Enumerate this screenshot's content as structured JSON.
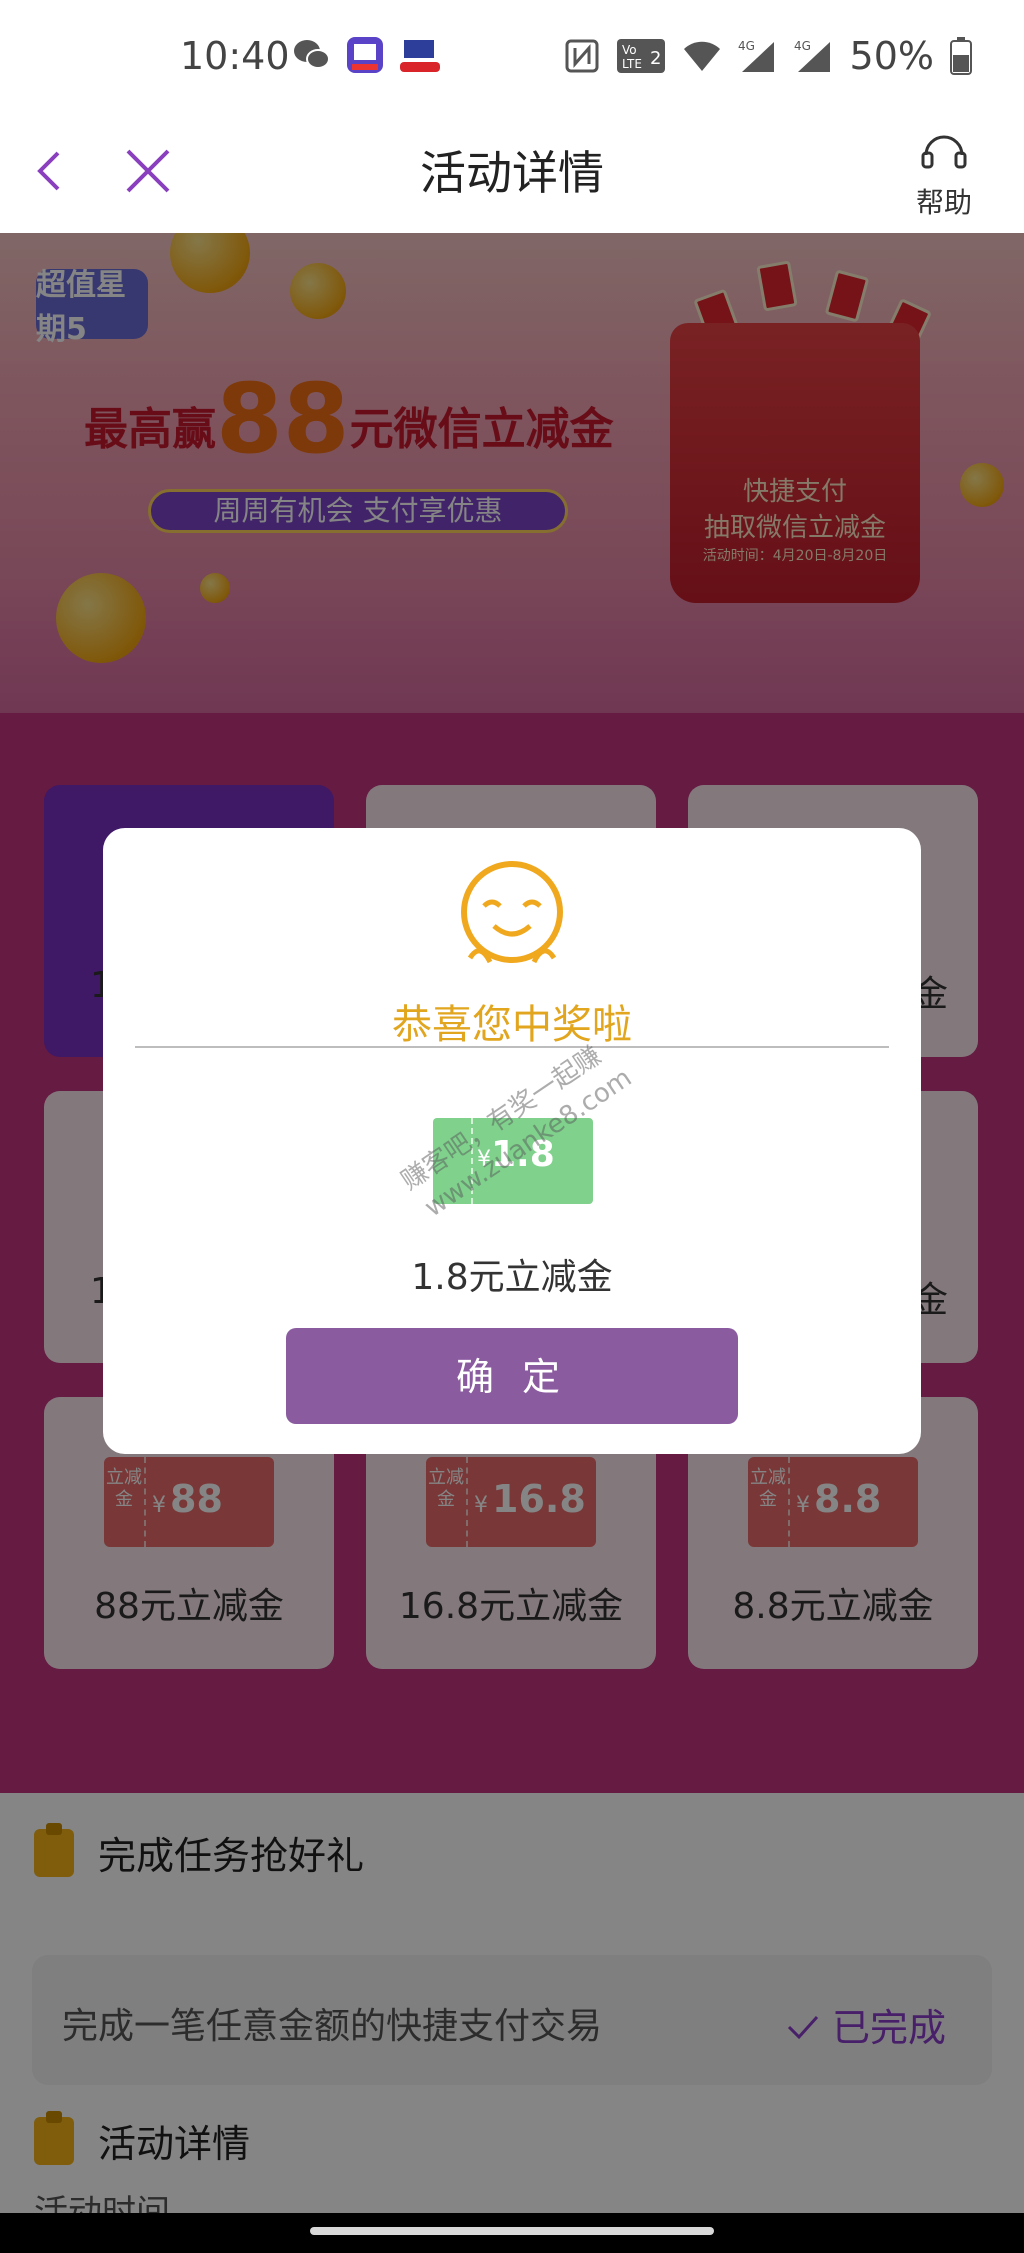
{
  "status_bar": {
    "time": "10:40",
    "left_icons": [
      "wechat-icon",
      "tie-app-icon",
      "bank-app-icon"
    ],
    "right_icons": [
      "nfc-icon",
      "volte-icon",
      "wifi-icon",
      "signal-4g-icon",
      "signal-4g-icon"
    ],
    "battery_percent": "50%"
  },
  "nav": {
    "title": "活动详情",
    "help_label": "帮助"
  },
  "banner": {
    "logo_text": "超值星期5",
    "headline_prefix": "最高赢",
    "headline_number": "88",
    "headline_suffix": "元微信立减金",
    "pill_text": "周周有机会 支付享优惠",
    "bag_line1": "快捷支付",
    "bag_line2": "抽取微信立减金",
    "bag_line3": "活动时间：4月20日-8月20日"
  },
  "prizes": [
    {
      "label": "1",
      "value": "",
      "active": true
    },
    {
      "label": "",
      "value": ""
    },
    {
      "label": "金",
      "value": ""
    },
    {
      "label": "1",
      "value": ""
    },
    {
      "label": "",
      "value": ""
    },
    {
      "label": "金",
      "value": ""
    },
    {
      "label": "88元立减金",
      "value": "88"
    },
    {
      "label": "16.8元立减金",
      "value": "16.8"
    },
    {
      "label": "8.8元立减金",
      "value": "8.8"
    }
  ],
  "voucher_side_text": "立减金",
  "currency": "¥",
  "info": {
    "task_title": "完成任务抢好礼",
    "task_desc": "完成一笔任意金额的快捷支付交易",
    "task_status": "已完成",
    "detail_title": "活动详情",
    "detail_sub": "活动时间"
  },
  "modal": {
    "title": "恭喜您中奖啦",
    "coupon_value": "1.8",
    "coupon_side": "立减金",
    "prize_text": "1.8元立减金",
    "confirm_label": "确 定",
    "watermark_1": "赚客吧，有奖一起赚",
    "watermark_2": "www.zuanke8.com"
  },
  "colors": {
    "accent_purple": "#8b5ba0",
    "title_gold": "#e2a51e",
    "status_done": "#8b3dc9"
  }
}
